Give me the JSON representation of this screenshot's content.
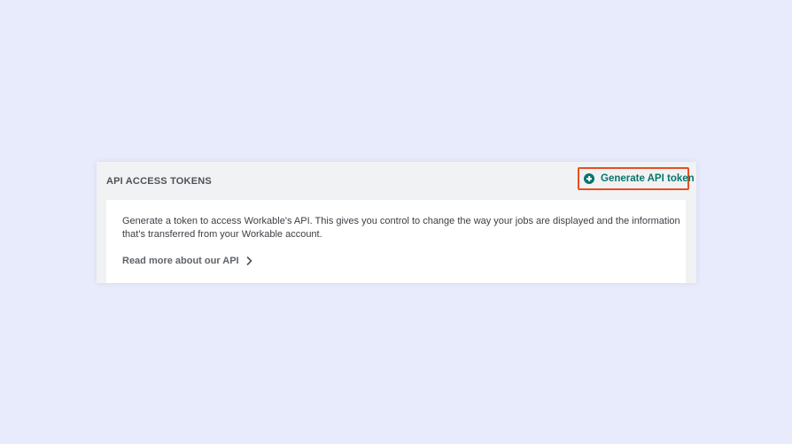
{
  "panel": {
    "title": "API ACCESS TOKENS",
    "generate_button": {
      "label": "Generate API token",
      "icon": "plus-circle-icon"
    },
    "description": "Generate a token to access Workable's API. This gives you control to change the way your jobs are displayed and the information that's transferred from your Workable account.",
    "read_more": {
      "label": "Read more about our API",
      "icon": "chevron-right-icon"
    }
  },
  "colors": {
    "page_background": "#e8ebfb",
    "panel_background": "#f1f2f4",
    "accent": "#08756b",
    "highlight": "#e8501f"
  }
}
